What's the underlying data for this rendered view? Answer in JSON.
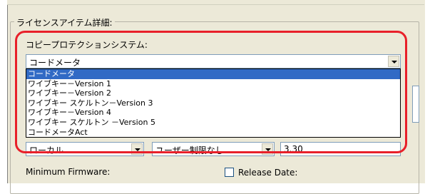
{
  "group": {
    "title": "ライセンスアイテム詳細:"
  },
  "copy_protection": {
    "label": "コピープロテクションシステム:",
    "selected": "コードメータ",
    "options": [
      "コードメータ",
      "ワイブキー－Version 1",
      "ワイブキー－Version 2",
      "ワイブキー スケルトン－Version 3",
      "ワイブキー－Version 4",
      "ワイブキー スケルトン －Version 5",
      "コードメータAct"
    ],
    "selected_index": 0
  },
  "license_row": {
    "location_value": "ローカル",
    "user_limit_value": "ユーザー制限なし",
    "version_value": "3.30"
  },
  "bottom": {
    "min_firmware_label": "Minimum Firmware:",
    "release_date_label": "Release Date:",
    "release_date_checked": false
  },
  "colors": {
    "highlight": "#e8202a",
    "selection": "#316ac5",
    "panel": "#ece9d8"
  }
}
